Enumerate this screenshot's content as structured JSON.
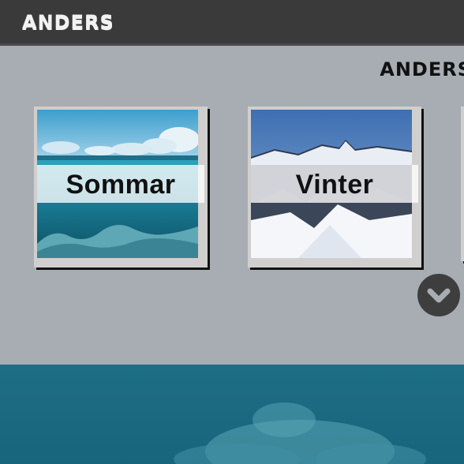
{
  "header": {
    "logo_text": "ANDERS"
  },
  "section": {
    "logo_text": "ANDERS"
  },
  "cards": [
    {
      "label": "Sommar"
    },
    {
      "label": "Vinter"
    }
  ],
  "scroll_button": {
    "icon": "chevron-down-icon"
  },
  "colors": {
    "header_bg": "#3a3a3a",
    "page_bg": "#a7adb2",
    "button_bg": "#3e3e3e",
    "ocean": "#1d6f86"
  }
}
